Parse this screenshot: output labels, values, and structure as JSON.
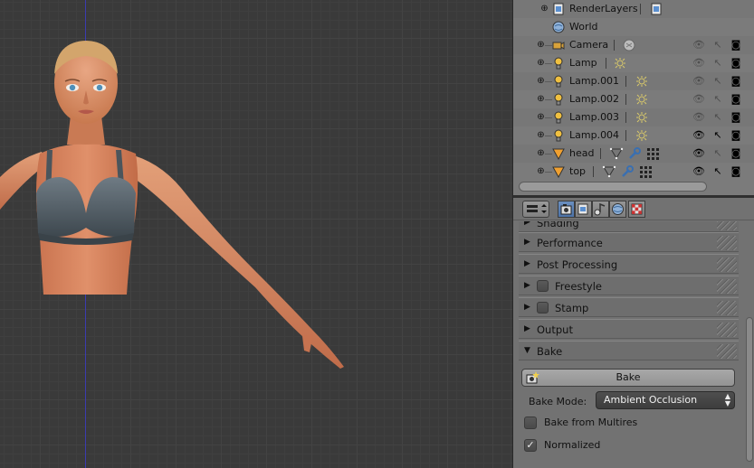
{
  "outliner": {
    "rows": [
      {
        "label": "RenderLayers",
        "icon": "render-layers-icon"
      },
      {
        "label": "World",
        "icon": "world-icon"
      },
      {
        "label": "Camera",
        "icon": "camera-icon"
      },
      {
        "label": "Lamp",
        "icon": "lamp-icon"
      },
      {
        "label": "Lamp.001",
        "icon": "lamp-icon"
      },
      {
        "label": "Lamp.002",
        "icon": "lamp-icon"
      },
      {
        "label": "Lamp.003",
        "icon": "lamp-icon"
      },
      {
        "label": "Lamp.004",
        "icon": "lamp-icon"
      },
      {
        "label": "head",
        "icon": "mesh-icon"
      },
      {
        "label": "top",
        "icon": "mesh-icon"
      }
    ]
  },
  "properties": {
    "panels": {
      "shading": "Shading",
      "performance": "Performance",
      "post_processing": "Post Processing",
      "freestyle": "Freestyle",
      "stamp": "Stamp",
      "output": "Output",
      "bake": "Bake"
    },
    "bake": {
      "button_label": "Bake",
      "mode_label": "Bake Mode:",
      "mode_value": "Ambient Occlusion",
      "from_multires_label": "Bake from Multires",
      "from_multires_checked": false,
      "normalized_label": "Normalized",
      "normalized_checked": true
    }
  },
  "colors": {
    "viewport_bg": "#393939",
    "panel_bg": "#727272",
    "active_tab": "#5a7fb5"
  }
}
